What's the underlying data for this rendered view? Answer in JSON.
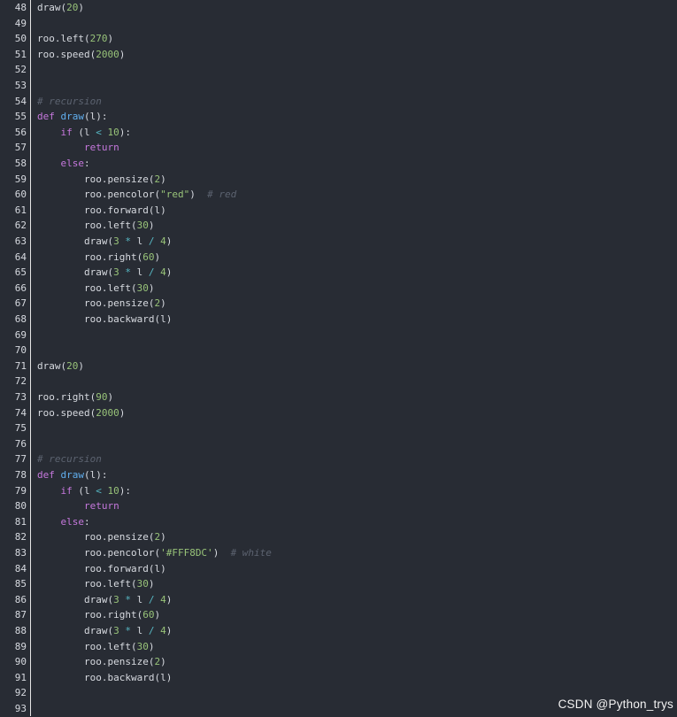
{
  "colors": {
    "background": "#282c34",
    "text": "#d7dae0",
    "keyword": "#c678dd",
    "function": "#61afef",
    "number": "#98c379",
    "operator": "#56b6c2",
    "comment": "#5c6370"
  },
  "watermark": "CSDN @Python_trys",
  "lines": [
    {
      "n": "48",
      "tokens": [
        [
          "draw",
          "t"
        ],
        [
          "(",
          "t"
        ],
        [
          "20",
          "num"
        ],
        [
          ")",
          "t"
        ]
      ]
    },
    {
      "n": "49",
      "tokens": []
    },
    {
      "n": "50",
      "tokens": [
        [
          "roo.left(",
          "t"
        ],
        [
          "270",
          "num"
        ],
        [
          ")",
          "t"
        ]
      ]
    },
    {
      "n": "51",
      "tokens": [
        [
          "roo.speed(",
          "t"
        ],
        [
          "2000",
          "num"
        ],
        [
          ")",
          "t"
        ]
      ]
    },
    {
      "n": "52",
      "tokens": []
    },
    {
      "n": "53",
      "tokens": []
    },
    {
      "n": "54",
      "tokens": [
        [
          "# recursion",
          "cm"
        ]
      ]
    },
    {
      "n": "55",
      "tokens": [
        [
          "def ",
          "kw"
        ],
        [
          "draw",
          "fn"
        ],
        [
          "(l):",
          "t"
        ]
      ]
    },
    {
      "n": "56",
      "tokens": [
        [
          "    ",
          "t"
        ],
        [
          "if ",
          "kw"
        ],
        [
          "(l ",
          "t"
        ],
        [
          "<",
          "op"
        ],
        [
          " ",
          "t"
        ],
        [
          "10",
          "num"
        ],
        [
          "):",
          "t"
        ]
      ]
    },
    {
      "n": "57",
      "tokens": [
        [
          "        ",
          "t"
        ],
        [
          "return",
          "kw"
        ]
      ]
    },
    {
      "n": "58",
      "tokens": [
        [
          "    ",
          "t"
        ],
        [
          "else",
          "kw"
        ],
        [
          ":",
          "t"
        ]
      ]
    },
    {
      "n": "59",
      "tokens": [
        [
          "        roo.pensize(",
          "t"
        ],
        [
          "2",
          "num"
        ],
        [
          ")",
          "t"
        ]
      ]
    },
    {
      "n": "60",
      "tokens": [
        [
          "        roo.pencolor(",
          "t"
        ],
        [
          "\"red\"",
          "str"
        ],
        [
          ")  ",
          "t"
        ],
        [
          "# red",
          "cm"
        ]
      ]
    },
    {
      "n": "61",
      "tokens": [
        [
          "        roo.forward(l)",
          "t"
        ]
      ]
    },
    {
      "n": "62",
      "tokens": [
        [
          "        roo.left(",
          "t"
        ],
        [
          "30",
          "num"
        ],
        [
          ")",
          "t"
        ]
      ]
    },
    {
      "n": "63",
      "tokens": [
        [
          "        draw(",
          "t"
        ],
        [
          "3",
          "num"
        ],
        [
          " ",
          "t"
        ],
        [
          "*",
          "op"
        ],
        [
          " l ",
          "t"
        ],
        [
          "/",
          "op"
        ],
        [
          " ",
          "t"
        ],
        [
          "4",
          "num"
        ],
        [
          ")",
          "t"
        ]
      ]
    },
    {
      "n": "64",
      "tokens": [
        [
          "        roo.right(",
          "t"
        ],
        [
          "60",
          "num"
        ],
        [
          ")",
          "t"
        ]
      ]
    },
    {
      "n": "65",
      "tokens": [
        [
          "        draw(",
          "t"
        ],
        [
          "3",
          "num"
        ],
        [
          " ",
          "t"
        ],
        [
          "*",
          "op"
        ],
        [
          " l ",
          "t"
        ],
        [
          "/",
          "op"
        ],
        [
          " ",
          "t"
        ],
        [
          "4",
          "num"
        ],
        [
          ")",
          "t"
        ]
      ]
    },
    {
      "n": "66",
      "tokens": [
        [
          "        roo.left(",
          "t"
        ],
        [
          "30",
          "num"
        ],
        [
          ")",
          "t"
        ]
      ]
    },
    {
      "n": "67",
      "tokens": [
        [
          "        roo.pensize(",
          "t"
        ],
        [
          "2",
          "num"
        ],
        [
          ")",
          "t"
        ]
      ]
    },
    {
      "n": "68",
      "tokens": [
        [
          "        roo.backward(l)",
          "t"
        ]
      ]
    },
    {
      "n": "69",
      "tokens": []
    },
    {
      "n": "70",
      "tokens": []
    },
    {
      "n": "71",
      "tokens": [
        [
          "draw(",
          "t"
        ],
        [
          "20",
          "num"
        ],
        [
          ")",
          "t"
        ]
      ]
    },
    {
      "n": "72",
      "tokens": []
    },
    {
      "n": "73",
      "tokens": [
        [
          "roo.right(",
          "t"
        ],
        [
          "90",
          "num"
        ],
        [
          ")",
          "t"
        ]
      ]
    },
    {
      "n": "74",
      "tokens": [
        [
          "roo.speed(",
          "t"
        ],
        [
          "2000",
          "num"
        ],
        [
          ")",
          "t"
        ]
      ]
    },
    {
      "n": "75",
      "tokens": []
    },
    {
      "n": "76",
      "tokens": []
    },
    {
      "n": "77",
      "tokens": [
        [
          "# recursion",
          "cm"
        ]
      ]
    },
    {
      "n": "78",
      "tokens": [
        [
          "def ",
          "kw"
        ],
        [
          "draw",
          "fn"
        ],
        [
          "(l):",
          "t"
        ]
      ]
    },
    {
      "n": "79",
      "tokens": [
        [
          "    ",
          "t"
        ],
        [
          "if ",
          "kw"
        ],
        [
          "(l ",
          "t"
        ],
        [
          "<",
          "op"
        ],
        [
          " ",
          "t"
        ],
        [
          "10",
          "num"
        ],
        [
          "):",
          "t"
        ]
      ]
    },
    {
      "n": "80",
      "tokens": [
        [
          "        ",
          "t"
        ],
        [
          "return",
          "kw"
        ]
      ]
    },
    {
      "n": "81",
      "tokens": [
        [
          "    ",
          "t"
        ],
        [
          "else",
          "kw"
        ],
        [
          ":",
          "t"
        ]
      ]
    },
    {
      "n": "82",
      "tokens": [
        [
          "        roo.pensize(",
          "t"
        ],
        [
          "2",
          "num"
        ],
        [
          ")",
          "t"
        ]
      ]
    },
    {
      "n": "83",
      "tokens": [
        [
          "        roo.pencolor(",
          "t"
        ],
        [
          "'#FFF8DC'",
          "str"
        ],
        [
          ")  ",
          "t"
        ],
        [
          "# white",
          "cm"
        ]
      ]
    },
    {
      "n": "84",
      "tokens": [
        [
          "        roo.forward(l)",
          "t"
        ]
      ]
    },
    {
      "n": "85",
      "tokens": [
        [
          "        roo.left(",
          "t"
        ],
        [
          "30",
          "num"
        ],
        [
          ")",
          "t"
        ]
      ]
    },
    {
      "n": "86",
      "tokens": [
        [
          "        draw(",
          "t"
        ],
        [
          "3",
          "num"
        ],
        [
          " ",
          "t"
        ],
        [
          "*",
          "op"
        ],
        [
          " l ",
          "t"
        ],
        [
          "/",
          "op"
        ],
        [
          " ",
          "t"
        ],
        [
          "4",
          "num"
        ],
        [
          ")",
          "t"
        ]
      ]
    },
    {
      "n": "87",
      "tokens": [
        [
          "        roo.right(",
          "t"
        ],
        [
          "60",
          "num"
        ],
        [
          ")",
          "t"
        ]
      ]
    },
    {
      "n": "88",
      "tokens": [
        [
          "        draw(",
          "t"
        ],
        [
          "3",
          "num"
        ],
        [
          " ",
          "t"
        ],
        [
          "*",
          "op"
        ],
        [
          " l ",
          "t"
        ],
        [
          "/",
          "op"
        ],
        [
          " ",
          "t"
        ],
        [
          "4",
          "num"
        ],
        [
          ")",
          "t"
        ]
      ]
    },
    {
      "n": "89",
      "tokens": [
        [
          "        roo.left(",
          "t"
        ],
        [
          "30",
          "num"
        ],
        [
          ")",
          "t"
        ]
      ]
    },
    {
      "n": "90",
      "tokens": [
        [
          "        roo.pensize(",
          "t"
        ],
        [
          "2",
          "num"
        ],
        [
          ")",
          "t"
        ]
      ]
    },
    {
      "n": "91",
      "tokens": [
        [
          "        roo.backward(l)",
          "t"
        ]
      ]
    },
    {
      "n": "92",
      "tokens": []
    },
    {
      "n": "93",
      "tokens": []
    }
  ]
}
